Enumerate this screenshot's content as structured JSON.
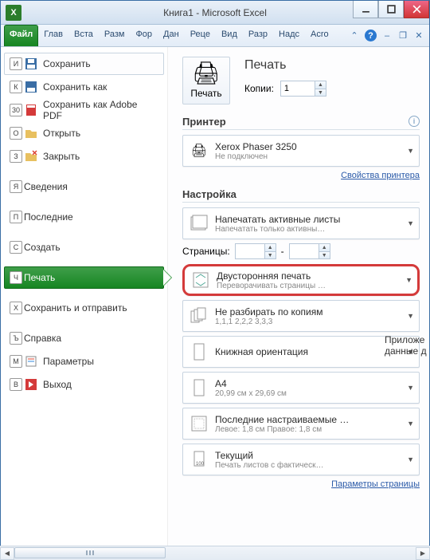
{
  "title": "Книга1 - Microsoft Excel",
  "excel_glyph": "X",
  "tabs": [
    "Файл",
    "Глав",
    "Вста",
    "Разм",
    "Фор",
    "Дан",
    "Реце",
    "Вид",
    "Разр",
    "Надс",
    "Acro"
  ],
  "help_glyph": "?",
  "menu": {
    "save": {
      "key": "И",
      "label": "Сохранить"
    },
    "saveas": {
      "key": "К",
      "label": "Сохранить как"
    },
    "savepdf": {
      "key": "30",
      "label": "Сохранить как Adobe PDF"
    },
    "open": {
      "key": "О",
      "label": "Открыть"
    },
    "close": {
      "key": "З",
      "label": "Закрыть"
    },
    "info": {
      "key": "Я",
      "label": "Сведения"
    },
    "recent": {
      "key": "П",
      "label": "Последние"
    },
    "new": {
      "key": "С",
      "label": "Создать"
    },
    "print": {
      "key": "Ч",
      "label": "Печать"
    },
    "share": {
      "key": "Х",
      "label": "Сохранить и отправить"
    },
    "help": {
      "key": "Ъ",
      "label": "Справка"
    },
    "options": {
      "key": "М",
      "label": "Параметры"
    },
    "exit": {
      "key": "В",
      "label": "Выход"
    }
  },
  "print": {
    "big_title": "Печать",
    "btn_label": "Печать",
    "copies_label": "Копии:",
    "copies_value": "1"
  },
  "printer": {
    "heading": "Принтер",
    "name": "Xerox Phaser 3250",
    "status": "Не подключен",
    "props_link": "Свойства принтера"
  },
  "settings": {
    "heading": "Настройка",
    "sheets": {
      "main": "Напечатать активные листы",
      "sub": "Напечатать только активны…"
    },
    "pages_label": "Страницы:",
    "dash": "-",
    "duplex": {
      "main": "Двусторонняя печать",
      "sub": "Переворачивать страницы …"
    },
    "collate": {
      "main": "Не разбирать по копиям",
      "sub": "1,1,1   2,2,2   3,3,3"
    },
    "orient": {
      "main": "Книжная ориентация",
      "sub": ""
    },
    "paper": {
      "main": "A4",
      "sub": "20,99 см x 29,69 см"
    },
    "margins": {
      "main": "Последние настраиваемые …",
      "sub": "Левое: 1,8 см   Правое: 1,8 см"
    },
    "scaling": {
      "main": "Текущий",
      "sub": "Печать листов с фактическ…"
    },
    "page_link": "Параметры страницы"
  },
  "side_text": "Приложе данные д"
}
